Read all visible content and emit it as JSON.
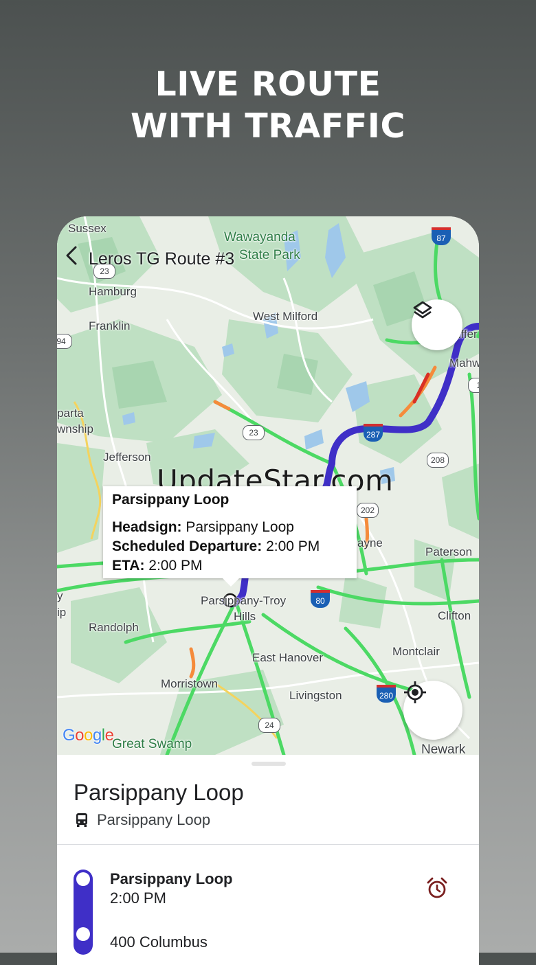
{
  "promo": {
    "headline_line1": "LIVE ROUTE",
    "headline_line2": "WITH TRAFFIC"
  },
  "header": {
    "back_icon": "chevron-left-icon",
    "title": "Leros TG Route #3"
  },
  "map": {
    "layers_icon": "layers-icon",
    "locate_icon": "crosshair-location-icon",
    "watermark": "UpdateStar.com",
    "attribution": "Google",
    "places": {
      "sussex": "Sussex",
      "wawayanda": "Wawayanda",
      "state_park": "State Park",
      "hamburg": "Hamburg",
      "franklin": "Franklin",
      "west_milford": "West Milford",
      "sparta": "parta",
      "township": "wnship",
      "jefferson": "Jefferson",
      "mahwah": "Mahw",
      "suffern": "uffer",
      "wayne": "ayne",
      "paterson": "Paterson",
      "parsippany": "Parsippany-Troy",
      "hills": "Hills",
      "randolph": "Randolph",
      "clifton": "Clifton",
      "montclair": "Montclair",
      "east_hanover": "East Hanover",
      "morristown": "Morristown",
      "livingston": "Livingston",
      "great_swamp": "Great Swamp",
      "newark": "Newark",
      "edge_y": "y",
      "edge_ip": "ip"
    },
    "shields": {
      "r23a": "23",
      "r94": "94",
      "r23b": "23",
      "r208": "208",
      "r202": "202",
      "r24": "24",
      "r1": "1",
      "i87": "87",
      "i287": "287",
      "i80": "80",
      "i280": "280"
    },
    "colors": {
      "route": "#3f2fc7",
      "traffic_free": "#4cd964",
      "traffic_slow": "#f58b3b",
      "traffic_heavy": "#d93025"
    }
  },
  "callout": {
    "title": "Parsippany Loop",
    "headsign_label": "Headsign:",
    "headsign_value": "Parsippany Loop",
    "departure_label": "Scheduled Departure:",
    "departure_value": "2:00 PM",
    "eta_label": "ETA:",
    "eta_value": "2:00 PM"
  },
  "sheet": {
    "title": "Parsippany Loop",
    "subtitle_icon": "bus-icon",
    "subtitle": "Parsippany Loop",
    "stops": [
      {
        "name": "Parsippany Loop",
        "time": "2:00 PM",
        "alarm_icon": "alarm-clock-icon"
      },
      {
        "name": "400 Columbus"
      }
    ]
  }
}
